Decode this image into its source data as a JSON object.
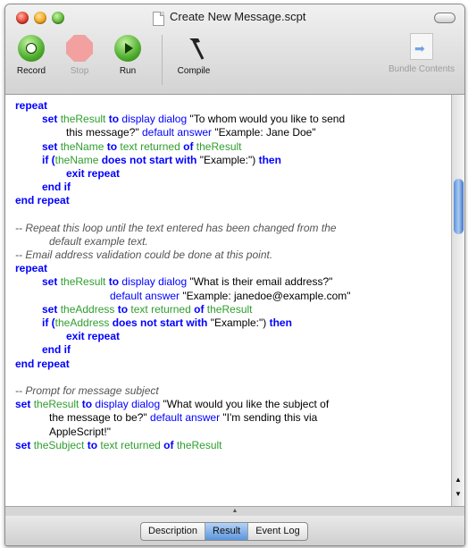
{
  "window": {
    "title": "Create New Message.scpt"
  },
  "toolbar": {
    "record": "Record",
    "stop": "Stop",
    "run": "Run",
    "compile": "Compile",
    "bundle_contents": "Bundle Contents"
  },
  "code": {
    "l1": [
      "repeat"
    ],
    "l2": [
      "set",
      "theResult",
      "to",
      "display dialog",
      "\"To whom would you like to send"
    ],
    "l3": [
      "this message?\"",
      "default answer",
      "\"Example: Jane Doe\""
    ],
    "l4": [
      "set",
      "theName",
      "to",
      "text returned",
      "of",
      "theResult"
    ],
    "l5": [
      "if (",
      "theName",
      "does not start with",
      "\"Example:\") ",
      "then"
    ],
    "l6": [
      "exit repeat"
    ],
    "l7": [
      "end if"
    ],
    "l8": [
      "end repeat"
    ],
    "c1": "-- Repeat this loop until the text entered has been changed from the",
    "c1b": "default example text.",
    "c2": "-- Email address validation could be done at this point.",
    "l9": [
      "repeat"
    ],
    "l10": [
      "set",
      "theResult",
      "to",
      "display dialog",
      "\"What is their email address?\""
    ],
    "l11": [
      "default answer",
      "\"Example: janedoe@example.com\""
    ],
    "l12": [
      "set",
      "theAddress",
      "to",
      "text returned",
      "of",
      "theResult"
    ],
    "l13": [
      "if (",
      "theAddress",
      "does not start with",
      "\"Example:\") ",
      "then"
    ],
    "l14": [
      "exit repeat"
    ],
    "l15": [
      "end if"
    ],
    "l16": [
      "end repeat"
    ],
    "c3": "-- Prompt for message subject",
    "l17": [
      "set",
      "theResult",
      "to",
      "display dialog",
      "\"What would you like the subject of"
    ],
    "l18": [
      "the message to be?\"",
      "default answer",
      "\"I'm sending this via"
    ],
    "l19": [
      "AppleScript!\""
    ],
    "l20": [
      "set",
      "theSubject",
      "to",
      "text returned",
      "of",
      "theResult"
    ]
  },
  "tabs": {
    "description": "Description",
    "result": "Result",
    "event_log": "Event Log"
  },
  "colors": {
    "keyword": "#0000ff",
    "variable": "#2e9e2e",
    "comment": "#555555",
    "selected_tab": "#5c95dd"
  }
}
